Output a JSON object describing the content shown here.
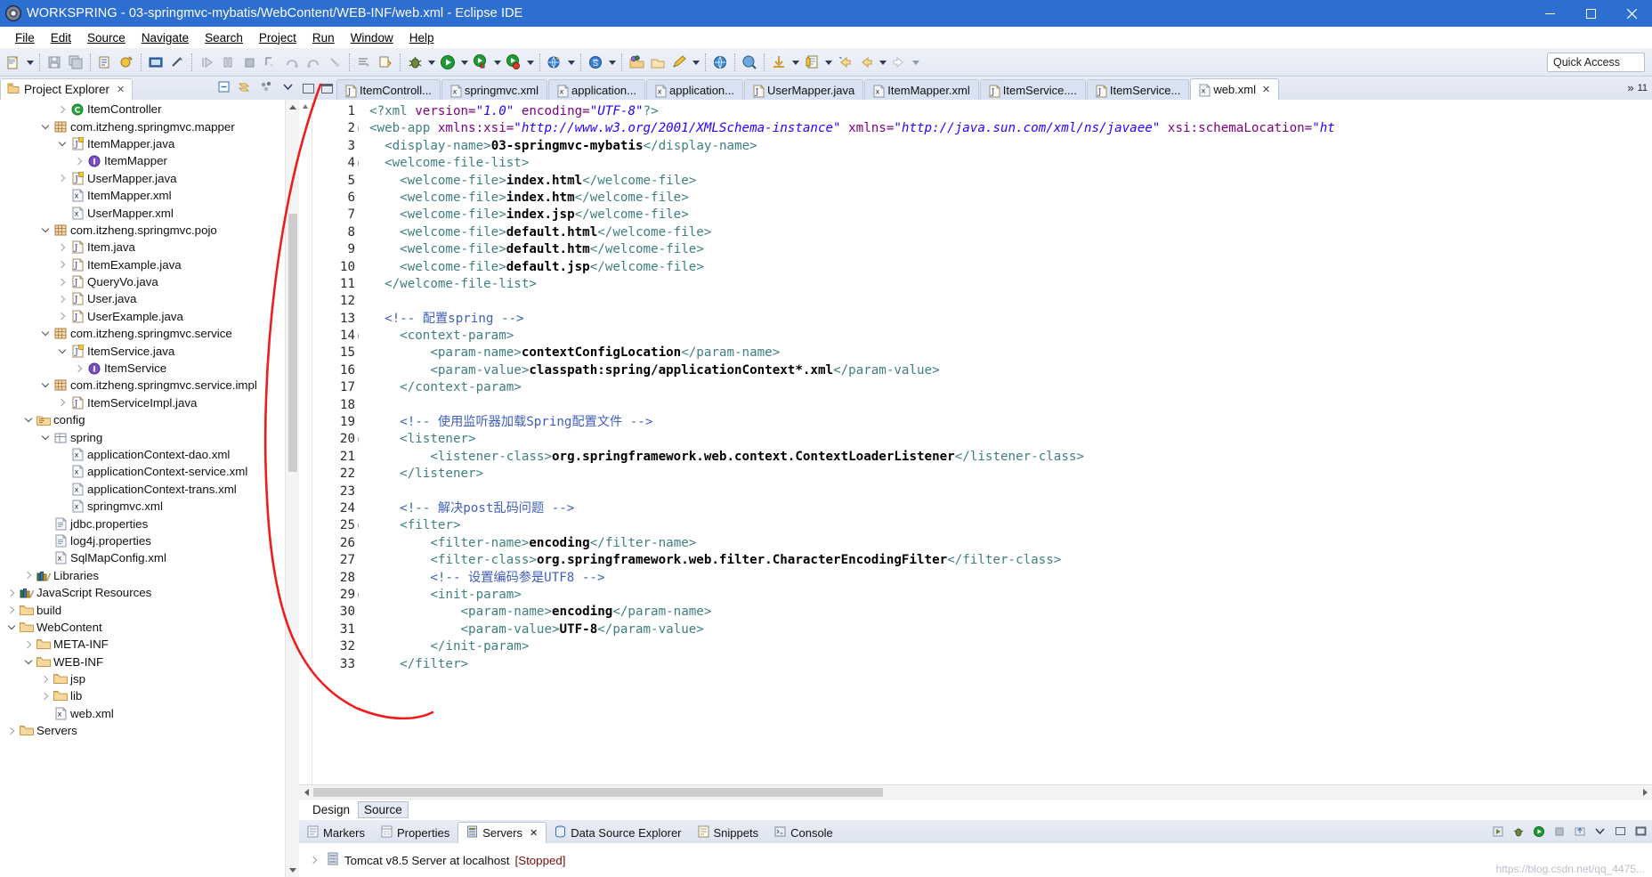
{
  "window": {
    "title": "WORKSPRING - 03-springmvc-mybatis/WebContent/WEB-INF/web.xml - Eclipse IDE",
    "app_icon": "eclipse-icon",
    "minimize": "minimize-icon",
    "maximize": "maximize-icon",
    "close": "close-icon"
  },
  "menubar": {
    "items": [
      {
        "label": "File"
      },
      {
        "label": "Edit"
      },
      {
        "label": "Source"
      },
      {
        "label": "Navigate"
      },
      {
        "label": "Search"
      },
      {
        "label": "Project"
      },
      {
        "label": "Run"
      },
      {
        "label": "Window"
      },
      {
        "label": "Help"
      }
    ]
  },
  "toolbar": {
    "quick_access": "Quick Access",
    "buttons": [
      "new-wizard-icon",
      "save-icon",
      "save-all-icon",
      "print-icon",
      "new-java-package-icon",
      "new-java-class-icon",
      "open-console-icon",
      "link-icon",
      "resume-icon",
      "suspend-icon",
      "terminate-icon",
      "step-into-icon",
      "step-over-icon",
      "step-return-icon",
      "drop-to-frame-icon",
      "skip-breakpoints-icon",
      "coverage-icon",
      "debug-icon",
      "run-icon",
      "run-as-server-icon",
      "stop-server-icon",
      "new-server-icon",
      "search-icon",
      "open-type-icon",
      "open-task-icon",
      "pencil-icon",
      "globe-icon",
      "profile-icon",
      "download-icon",
      "last-edit-icon",
      "previous-annotation-icon",
      "back-icon",
      "forward-icon"
    ]
  },
  "project_explorer": {
    "tab_label": "Project Explorer",
    "close_icon": "close-icon",
    "tools": [
      "collapse-all-icon",
      "link-with-editor-icon",
      "view-menu-icon",
      "view-chevron-icon"
    ],
    "tree": [
      {
        "indent": 3,
        "twisty": "right",
        "icon": "class-icon",
        "label": "ItemController"
      },
      {
        "indent": 2,
        "twisty": "down",
        "icon": "package-icon",
        "label": "com.itzheng.springmvc.mapper"
      },
      {
        "indent": 3,
        "twisty": "down",
        "icon": "java-interface-file-icon",
        "label": "ItemMapper.java"
      },
      {
        "indent": 4,
        "twisty": "right",
        "icon": "interface-icon",
        "label": "ItemMapper"
      },
      {
        "indent": 3,
        "twisty": "right",
        "icon": "java-interface-file-icon",
        "label": "UserMapper.java"
      },
      {
        "indent": 3,
        "twisty": "none",
        "icon": "xml-icon",
        "label": "ItemMapper.xml"
      },
      {
        "indent": 3,
        "twisty": "none",
        "icon": "xml-icon",
        "label": "UserMapper.xml"
      },
      {
        "indent": 2,
        "twisty": "down",
        "icon": "package-icon",
        "label": "com.itzheng.springmvc.pojo"
      },
      {
        "indent": 3,
        "twisty": "right",
        "icon": "java-file-icon",
        "label": "Item.java"
      },
      {
        "indent": 3,
        "twisty": "right",
        "icon": "java-file-icon",
        "label": "ItemExample.java"
      },
      {
        "indent": 3,
        "twisty": "right",
        "icon": "java-file-icon",
        "label": "QueryVo.java"
      },
      {
        "indent": 3,
        "twisty": "right",
        "icon": "java-file-icon",
        "label": "User.java"
      },
      {
        "indent": 3,
        "twisty": "right",
        "icon": "java-file-icon",
        "label": "UserExample.java"
      },
      {
        "indent": 2,
        "twisty": "down",
        "icon": "package-icon",
        "label": "com.itzheng.springmvc.service"
      },
      {
        "indent": 3,
        "twisty": "down",
        "icon": "java-interface-file-icon",
        "label": "ItemService.java"
      },
      {
        "indent": 4,
        "twisty": "right",
        "icon": "interface-icon",
        "label": "ItemService"
      },
      {
        "indent": 2,
        "twisty": "down",
        "icon": "package-icon",
        "label": "com.itzheng.springmvc.service.impl"
      },
      {
        "indent": 3,
        "twisty": "right",
        "icon": "java-file-icon",
        "label": "ItemServiceImpl.java"
      },
      {
        "indent": 1,
        "twisty": "down",
        "icon": "source-folder-icon",
        "label": "config"
      },
      {
        "indent": 2,
        "twisty": "down",
        "icon": "package-folder-icon",
        "label": "spring"
      },
      {
        "indent": 3,
        "twisty": "none",
        "icon": "xml-icon",
        "label": "applicationContext-dao.xml"
      },
      {
        "indent": 3,
        "twisty": "none",
        "icon": "xml-icon",
        "label": "applicationContext-service.xml"
      },
      {
        "indent": 3,
        "twisty": "none",
        "icon": "xml-icon",
        "label": "applicationContext-trans.xml"
      },
      {
        "indent": 3,
        "twisty": "none",
        "icon": "xml-icon",
        "label": "springmvc.xml"
      },
      {
        "indent": 2,
        "twisty": "none",
        "icon": "properties-icon",
        "label": "jdbc.properties"
      },
      {
        "indent": 2,
        "twisty": "none",
        "icon": "properties-icon",
        "label": "log4j.properties"
      },
      {
        "indent": 2,
        "twisty": "none",
        "icon": "xml-icon",
        "label": "SqlMapConfig.xml"
      },
      {
        "indent": 1,
        "twisty": "right",
        "icon": "libraries-icon",
        "label": "Libraries"
      },
      {
        "indent": 0,
        "twisty": "right",
        "icon": "libraries-icon",
        "label": "JavaScript Resources"
      },
      {
        "indent": 0,
        "twisty": "right",
        "icon": "folder-icon",
        "label": "build"
      },
      {
        "indent": 0,
        "twisty": "down",
        "icon": "folder-icon",
        "label": "WebContent"
      },
      {
        "indent": 1,
        "twisty": "right",
        "icon": "folder-icon",
        "label": "META-INF"
      },
      {
        "indent": 1,
        "twisty": "down",
        "icon": "folder-icon",
        "label": "WEB-INF"
      },
      {
        "indent": 2,
        "twisty": "right",
        "icon": "folder-icon",
        "label": "jsp"
      },
      {
        "indent": 2,
        "twisty": "right",
        "icon": "folder-icon",
        "label": "lib"
      },
      {
        "indent": 2,
        "twisty": "none",
        "icon": "xml-icon",
        "label": "web.xml"
      },
      {
        "indent": 0,
        "twisty": "right",
        "icon": "server-folder-icon",
        "label": "Servers"
      }
    ]
  },
  "editor": {
    "minimize_icon": "minimize-view-icon",
    "maximize_icon": "maximize-view-icon",
    "overflow_chevron": "»",
    "overflow_count": "11",
    "tabs": [
      {
        "label": "ItemControll...",
        "icon": "java-file-icon",
        "active": false
      },
      {
        "label": "springmvc.xml",
        "icon": "xml-icon",
        "active": false
      },
      {
        "label": "application...",
        "icon": "xml-icon",
        "active": false
      },
      {
        "label": "application...",
        "icon": "xml-icon",
        "active": false
      },
      {
        "label": "UserMapper.java",
        "icon": "java-file-icon",
        "active": false
      },
      {
        "label": "ItemMapper.xml",
        "icon": "xml-icon",
        "active": false
      },
      {
        "label": "ItemService....",
        "icon": "java-file-icon",
        "active": false
      },
      {
        "label": "ItemService...",
        "icon": "java-file-icon",
        "active": false
      },
      {
        "label": "web.xml",
        "icon": "xml-icon",
        "active": true,
        "close_icon": "close-icon"
      }
    ],
    "modes": [
      {
        "label": "Design",
        "active": false
      },
      {
        "label": "Source",
        "active": true
      }
    ],
    "lines": [
      {
        "n": 1,
        "fold": false,
        "tokens": [
          {
            "t": "tg",
            "s": "<?xml "
          },
          {
            "t": "at",
            "s": "version="
          },
          {
            "t": "vl",
            "s": "\"1.0\""
          },
          {
            "t": "at",
            "s": " encoding="
          },
          {
            "t": "vl",
            "s": "\"UTF-8\""
          },
          {
            "t": "tg",
            "s": "?>"
          }
        ]
      },
      {
        "n": 2,
        "fold": true,
        "tokens": [
          {
            "t": "tg",
            "s": "<web-app "
          },
          {
            "t": "at",
            "s": "xmlns:xsi="
          },
          {
            "t": "vl",
            "s": "\"http://www.w3.org/2001/XMLSchema-instance\""
          },
          {
            "t": "at",
            "s": " xmlns="
          },
          {
            "t": "vl",
            "s": "\"http://java.sun.com/xml/ns/javaee\""
          },
          {
            "t": "at",
            "s": " xsi:schemaLocation="
          },
          {
            "t": "vl",
            "s": "\"ht"
          }
        ]
      },
      {
        "n": 3,
        "fold": false,
        "tokens": [
          {
            "t": "sp",
            "s": "  "
          },
          {
            "t": "tg",
            "s": "<display-name>"
          },
          {
            "t": "tx",
            "s": "03-springmvc-mybatis"
          },
          {
            "t": "tg",
            "s": "</display-name>"
          }
        ]
      },
      {
        "n": 4,
        "fold": true,
        "tokens": [
          {
            "t": "sp",
            "s": "  "
          },
          {
            "t": "tg",
            "s": "<welcome-file-list>"
          }
        ]
      },
      {
        "n": 5,
        "fold": false,
        "tokens": [
          {
            "t": "sp",
            "s": "    "
          },
          {
            "t": "tg",
            "s": "<welcome-file>"
          },
          {
            "t": "tx",
            "s": "index.html"
          },
          {
            "t": "tg",
            "s": "</welcome-file>"
          }
        ]
      },
      {
        "n": 6,
        "fold": false,
        "tokens": [
          {
            "t": "sp",
            "s": "    "
          },
          {
            "t": "tg",
            "s": "<welcome-file>"
          },
          {
            "t": "tx",
            "s": "index.htm"
          },
          {
            "t": "tg",
            "s": "</welcome-file>"
          }
        ]
      },
      {
        "n": 7,
        "fold": false,
        "tokens": [
          {
            "t": "sp",
            "s": "    "
          },
          {
            "t": "tg",
            "s": "<welcome-file>"
          },
          {
            "t": "tx",
            "s": "index.jsp"
          },
          {
            "t": "tg",
            "s": "</welcome-file>"
          }
        ]
      },
      {
        "n": 8,
        "fold": false,
        "tokens": [
          {
            "t": "sp",
            "s": "    "
          },
          {
            "t": "tg",
            "s": "<welcome-file>"
          },
          {
            "t": "tx",
            "s": "default.html"
          },
          {
            "t": "tg",
            "s": "</welcome-file>"
          }
        ]
      },
      {
        "n": 9,
        "fold": false,
        "tokens": [
          {
            "t": "sp",
            "s": "    "
          },
          {
            "t": "tg",
            "s": "<welcome-file>"
          },
          {
            "t": "tx",
            "s": "default.htm"
          },
          {
            "t": "tg",
            "s": "</welcome-file>"
          }
        ]
      },
      {
        "n": 10,
        "fold": false,
        "tokens": [
          {
            "t": "sp",
            "s": "    "
          },
          {
            "t": "tg",
            "s": "<welcome-file>"
          },
          {
            "t": "tx",
            "s": "default.jsp"
          },
          {
            "t": "tg",
            "s": "</welcome-file>"
          }
        ]
      },
      {
        "n": 11,
        "fold": false,
        "tokens": [
          {
            "t": "sp",
            "s": "  "
          },
          {
            "t": "tg",
            "s": "</welcome-file-list>"
          }
        ]
      },
      {
        "n": 12,
        "fold": false,
        "tokens": []
      },
      {
        "n": 13,
        "fold": false,
        "tokens": [
          {
            "t": "sp",
            "s": "  "
          },
          {
            "t": "cm",
            "s": "<!-- 配置spring -->"
          }
        ]
      },
      {
        "n": 14,
        "fold": true,
        "tokens": [
          {
            "t": "sp",
            "s": "    "
          },
          {
            "t": "tg",
            "s": "<context-param>"
          }
        ]
      },
      {
        "n": 15,
        "fold": false,
        "tokens": [
          {
            "t": "sp",
            "s": "        "
          },
          {
            "t": "tg",
            "s": "<param-name>"
          },
          {
            "t": "tx",
            "s": "contextConfigLocation"
          },
          {
            "t": "tg",
            "s": "</param-name>"
          }
        ]
      },
      {
        "n": 16,
        "fold": false,
        "tokens": [
          {
            "t": "sp",
            "s": "        "
          },
          {
            "t": "tg",
            "s": "<param-value>"
          },
          {
            "t": "tx",
            "s": "classpath:spring/applicationContext*.xml"
          },
          {
            "t": "tg",
            "s": "</param-value>"
          }
        ]
      },
      {
        "n": 17,
        "fold": false,
        "tokens": [
          {
            "t": "sp",
            "s": "    "
          },
          {
            "t": "tg",
            "s": "</context-param>"
          }
        ]
      },
      {
        "n": 18,
        "fold": false,
        "tokens": []
      },
      {
        "n": 19,
        "fold": false,
        "tokens": [
          {
            "t": "sp",
            "s": "    "
          },
          {
            "t": "cm",
            "s": "<!-- 使用监听器加载Spring配置文件 -->"
          }
        ]
      },
      {
        "n": 20,
        "fold": true,
        "tokens": [
          {
            "t": "sp",
            "s": "    "
          },
          {
            "t": "tg",
            "s": "<listener>"
          }
        ]
      },
      {
        "n": 21,
        "fold": false,
        "tokens": [
          {
            "t": "sp",
            "s": "        "
          },
          {
            "t": "tg",
            "s": "<listener-class>"
          },
          {
            "t": "tx",
            "s": "org.springframework.web.context.ContextLoaderListener"
          },
          {
            "t": "tg",
            "s": "</listener-class>"
          }
        ]
      },
      {
        "n": 22,
        "fold": false,
        "tokens": [
          {
            "t": "sp",
            "s": "    "
          },
          {
            "t": "tg",
            "s": "</listener>"
          }
        ]
      },
      {
        "n": 23,
        "fold": false,
        "tokens": []
      },
      {
        "n": 24,
        "fold": false,
        "tokens": [
          {
            "t": "sp",
            "s": "    "
          },
          {
            "t": "cm",
            "s": "<!-- 解决post乱码问题 -->"
          }
        ]
      },
      {
        "n": 25,
        "fold": true,
        "tokens": [
          {
            "t": "sp",
            "s": "    "
          },
          {
            "t": "tg",
            "s": "<filter>"
          }
        ]
      },
      {
        "n": 26,
        "fold": false,
        "tokens": [
          {
            "t": "sp",
            "s": "        "
          },
          {
            "t": "tg",
            "s": "<filter-name>"
          },
          {
            "t": "tx",
            "s": "encoding"
          },
          {
            "t": "tg",
            "s": "</filter-name>"
          }
        ]
      },
      {
        "n": 27,
        "fold": false,
        "tokens": [
          {
            "t": "sp",
            "s": "        "
          },
          {
            "t": "tg",
            "s": "<filter-class>"
          },
          {
            "t": "tx",
            "s": "org.springframework.web.filter.CharacterEncodingFilter"
          },
          {
            "t": "tg",
            "s": "</filter-class>"
          }
        ]
      },
      {
        "n": 28,
        "fold": false,
        "tokens": [
          {
            "t": "sp",
            "s": "        "
          },
          {
            "t": "cm",
            "s": "<!-- 设置编码参是UTF8 -->"
          }
        ]
      },
      {
        "n": 29,
        "fold": true,
        "tokens": [
          {
            "t": "sp",
            "s": "        "
          },
          {
            "t": "tg",
            "s": "<init-param>"
          }
        ]
      },
      {
        "n": 30,
        "fold": false,
        "tokens": [
          {
            "t": "sp",
            "s": "            "
          },
          {
            "t": "tg",
            "s": "<param-name>"
          },
          {
            "t": "tx",
            "s": "encoding"
          },
          {
            "t": "tg",
            "s": "</param-name>"
          }
        ]
      },
      {
        "n": 31,
        "fold": false,
        "tokens": [
          {
            "t": "sp",
            "s": "            "
          },
          {
            "t": "tg",
            "s": "<param-value>"
          },
          {
            "t": "tx",
            "s": "UTF-8"
          },
          {
            "t": "tg",
            "s": "</param-value>"
          }
        ]
      },
      {
        "n": 32,
        "fold": false,
        "tokens": [
          {
            "t": "sp",
            "s": "        "
          },
          {
            "t": "tg",
            "s": "</init-param>"
          }
        ]
      },
      {
        "n": 33,
        "fold": false,
        "tokens": [
          {
            "t": "sp",
            "s": "    "
          },
          {
            "t": "tg",
            "s": "</filter>"
          }
        ]
      }
    ]
  },
  "bottom_panel": {
    "tabs": [
      {
        "label": "Markers",
        "icon": "markers-icon",
        "active": false
      },
      {
        "label": "Properties",
        "icon": "properties-view-icon",
        "active": false
      },
      {
        "label": "Servers",
        "icon": "servers-icon",
        "active": true,
        "close_icon": "close-icon"
      },
      {
        "label": "Data Source Explorer",
        "icon": "data-source-icon",
        "active": false
      },
      {
        "label": "Snippets",
        "icon": "snippets-icon",
        "active": false
      },
      {
        "label": "Console",
        "icon": "console-icon",
        "active": false
      }
    ],
    "tools": [
      "start-server-icon",
      "debug-server-icon",
      "profile-server-icon",
      "stop-server-icon",
      "publish-icon",
      "view-menu-icon",
      "minimize-icon",
      "maximize-icon"
    ],
    "server_row": {
      "twisty": "right",
      "icon": "server-icon",
      "name": "Tomcat v8.5 Server at localhost",
      "status": "[Stopped]"
    }
  },
  "watermark": "https://blog.csdn.net/qq_4475..."
}
